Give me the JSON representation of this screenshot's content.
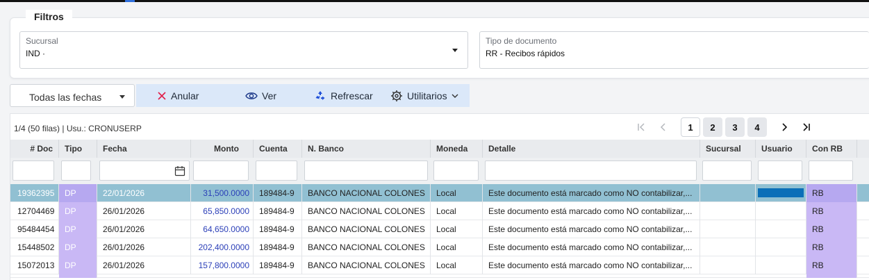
{
  "filters": {
    "legend": "Filtros",
    "sucursal": {
      "label": "Sucursal",
      "value": "IND ·"
    },
    "tipo_documento": {
      "label": "Tipo de documento",
      "value": "RR - Recibos rápidos"
    }
  },
  "toolbar": {
    "date_filter": "Todas las fechas",
    "anular": "Anular",
    "ver": "Ver",
    "refrescar": "Refrescar",
    "utilitarios": "Utilitarios"
  },
  "grid": {
    "status": "1/4 (50 filas) | Usu.: CRONUSERP",
    "pages": [
      "1",
      "2",
      "3",
      "4"
    ],
    "current_page": "1",
    "columns": [
      "# Doc",
      "Tipo",
      "Fecha",
      "Monto",
      "Cuenta",
      "N. Banco",
      "Moneda",
      "Detalle",
      "Sucursal",
      "Usuario",
      "Con RB"
    ],
    "rows": [
      {
        "doc": "19362395",
        "tipo": "DP",
        "fecha": "22/01/2026",
        "monto": "31,500.0000",
        "cuenta": "189484-9",
        "banco": "BANCO NACIONAL COLONES",
        "moneda": "Local",
        "detalle": "Este documento está marcado como NO contabilizar,...",
        "sucursal": "",
        "usuario": "",
        "con_rb": "RB"
      },
      {
        "doc": "12704469",
        "tipo": "DP",
        "fecha": "26/01/2026",
        "monto": "65,850.0000",
        "cuenta": "189484-9",
        "banco": "BANCO NACIONAL COLONES",
        "moneda": "Local",
        "detalle": "Este documento está marcado como NO contabilizar,...",
        "sucursal": "",
        "usuario": "",
        "con_rb": "RB"
      },
      {
        "doc": "95484454",
        "tipo": "DP",
        "fecha": "26/01/2026",
        "monto": "64,650.0000",
        "cuenta": "189484-9",
        "banco": "BANCO NACIONAL COLONES",
        "moneda": "Local",
        "detalle": "Este documento está marcado como NO contabilizar,...",
        "sucursal": "",
        "usuario": "",
        "con_rb": "RB"
      },
      {
        "doc": "15448502",
        "tipo": "DP",
        "fecha": "26/01/2026",
        "monto": "202,400.0000",
        "cuenta": "189484-9",
        "banco": "BANCO NACIONAL COLONES",
        "moneda": "Local",
        "detalle": "Este documento está marcado como NO contabilizar,...",
        "sucursal": "",
        "usuario": "",
        "con_rb": "RB"
      },
      {
        "doc": "15072013",
        "tipo": "DP",
        "fecha": "26/01/2026",
        "monto": "157,800.0000",
        "cuenta": "189484-9",
        "banco": "BANCO NACIONAL COLONES",
        "moneda": "Local",
        "detalle": "Este documento está marcado como NO contabilizar,...",
        "sucursal": "",
        "usuario": "",
        "con_rb": "RB"
      }
    ]
  },
  "colors": {
    "selected_row": "#91c0d2",
    "tipo_badge": "#c9b8f5",
    "monto_text": "#2b3fb8",
    "action_bar": "#dbe8f9",
    "anular_icon": "#e11d48",
    "refresh_icon": "#1d4ed8"
  },
  "icons": [
    "close-icon",
    "eye-icon",
    "recycle-icon",
    "gear-icon",
    "chevron-down-icon",
    "calendar-icon",
    "first-page-icon",
    "prev-page-icon",
    "next-page-icon",
    "last-page-icon"
  ]
}
